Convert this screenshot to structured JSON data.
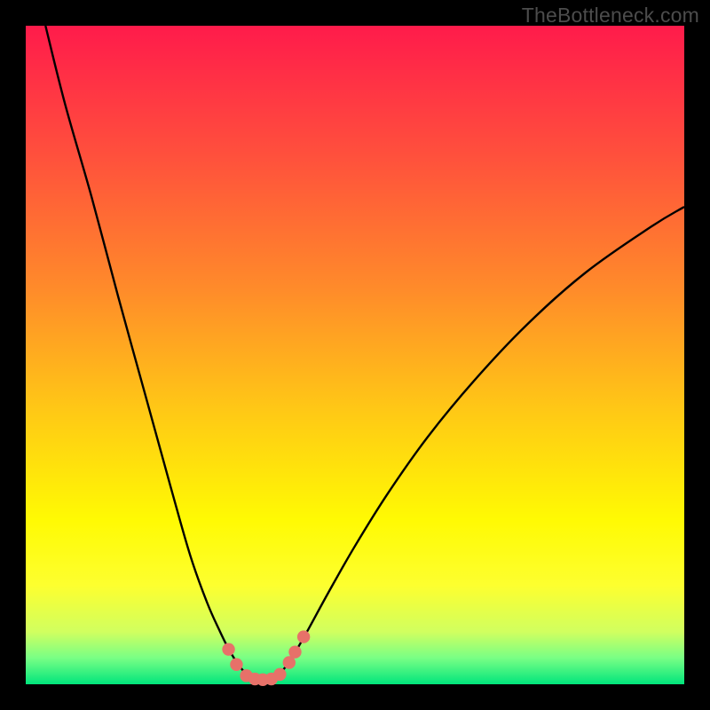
{
  "watermark": {
    "text": "TheBottleneck.com"
  },
  "colors": {
    "frame": "#000000",
    "watermark_text": "#4c4c4c",
    "curve_stroke": "#000000",
    "marker_fill": "#e77169",
    "gradient_stops": [
      {
        "pos": 0.0,
        "color": "#ff1b4b"
      },
      {
        "pos": 0.2,
        "color": "#ff513c"
      },
      {
        "pos": 0.4,
        "color": "#ff8b2a"
      },
      {
        "pos": 0.58,
        "color": "#ffc716"
      },
      {
        "pos": 0.75,
        "color": "#fffa03"
      },
      {
        "pos": 0.85,
        "color": "#fdff2f"
      },
      {
        "pos": 0.92,
        "color": "#d1ff5f"
      },
      {
        "pos": 0.96,
        "color": "#79ff85"
      },
      {
        "pos": 1.0,
        "color": "#01e57c"
      }
    ]
  },
  "chart_data": {
    "type": "line",
    "title": "",
    "xlabel": "",
    "ylabel": "",
    "xlim": [
      0,
      100
    ],
    "ylim": [
      0,
      100
    ],
    "grid": false,
    "legend": false,
    "series": [
      {
        "name": "left-branch",
        "x": [
          3,
          6,
          10,
          14,
          18,
          22,
          25,
          27.5,
          29.5,
          31,
          32.5,
          33.8
        ],
        "y": [
          100,
          88,
          74,
          59,
          44.5,
          30,
          19.5,
          12.5,
          8,
          5,
          2.7,
          1.2
        ]
      },
      {
        "name": "right-branch",
        "x": [
          38.2,
          39.5,
          41,
          43,
          46,
          50,
          55,
          61,
          68,
          76,
          85,
          95,
          100
        ],
        "y": [
          1.2,
          2.7,
          5,
          8.5,
          14,
          21,
          29,
          37.5,
          46,
          54.5,
          62.5,
          69.5,
          72.5
        ]
      },
      {
        "name": "valley-floor",
        "x": [
          33.8,
          35,
          36,
          37,
          38.2
        ],
        "y": [
          1.2,
          0.6,
          0.5,
          0.6,
          1.2
        ]
      }
    ],
    "markers": [
      {
        "x": 30.8,
        "y": 5.3
      },
      {
        "x": 32.0,
        "y": 3.0
      },
      {
        "x": 33.5,
        "y": 1.3
      },
      {
        "x": 34.8,
        "y": 0.8
      },
      {
        "x": 36.0,
        "y": 0.7
      },
      {
        "x": 37.3,
        "y": 0.8
      },
      {
        "x": 38.6,
        "y": 1.5
      },
      {
        "x": 40.0,
        "y": 3.3
      },
      {
        "x": 40.9,
        "y": 4.9
      },
      {
        "x": 42.2,
        "y": 7.2
      }
    ]
  }
}
